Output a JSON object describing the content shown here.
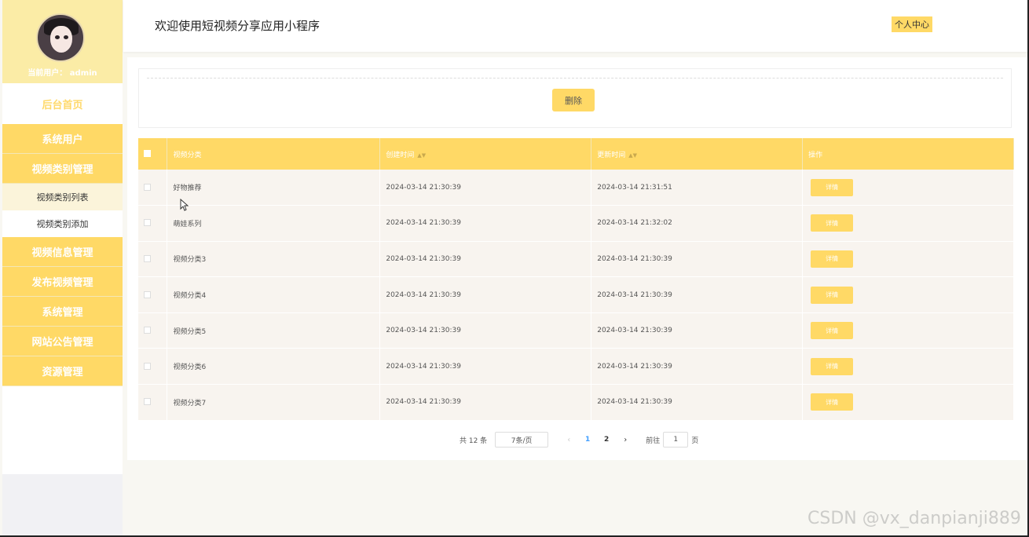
{
  "app": {
    "title": "欢迎使用短视频分享应用小程序",
    "personal_center": "个人中心"
  },
  "sidebar": {
    "current_user": "当前用户：  admin",
    "home": "后台首页",
    "items": [
      {
        "label": "系统用户"
      },
      {
        "label": "视频类别管理"
      },
      {
        "label": "视频信息管理"
      },
      {
        "label": "发布视频管理"
      },
      {
        "label": "系统管理"
      },
      {
        "label": "网站公告管理"
      },
      {
        "label": "资源管理"
      }
    ],
    "sub_items": [
      {
        "label": "视频类别列表"
      },
      {
        "label": "视频类别添加"
      }
    ]
  },
  "toolbar": {
    "delete_label": "删除"
  },
  "table": {
    "headers": [
      "视频分类",
      "创建时间",
      "更新时间",
      "操作"
    ],
    "detail_label": "详情",
    "rows": [
      {
        "category": "好物推荐",
        "created": "2024-03-14 21:30:39",
        "updated": "2024-03-14 21:31:51"
      },
      {
        "category": "萌娃系列",
        "created": "2024-03-14 21:30:39",
        "updated": "2024-03-14 21:32:02"
      },
      {
        "category": "视频分类3",
        "created": "2024-03-14 21:30:39",
        "updated": "2024-03-14 21:30:39"
      },
      {
        "category": "视频分类4",
        "created": "2024-03-14 21:30:39",
        "updated": "2024-03-14 21:30:39"
      },
      {
        "category": "视频分类5",
        "created": "2024-03-14 21:30:39",
        "updated": "2024-03-14 21:30:39"
      },
      {
        "category": "视频分类6",
        "created": "2024-03-14 21:30:39",
        "updated": "2024-03-14 21:30:39"
      },
      {
        "category": "视频分类7",
        "created": "2024-03-14 21:30:39",
        "updated": "2024-03-14 21:30:39"
      }
    ]
  },
  "pagination": {
    "total": "共 12 条",
    "page_size": "7条/页",
    "pages": [
      "1",
      "2"
    ],
    "goto_label": "前往",
    "goto_value": "1",
    "page_suffix": "页"
  },
  "watermark": "CSDN @vx_danpianji889",
  "colors": {
    "accent": "#ffd966",
    "sidebar_profile_bg": "#fbeca6",
    "row_bg": "#f8f4ef",
    "active_page": "#409eff"
  }
}
